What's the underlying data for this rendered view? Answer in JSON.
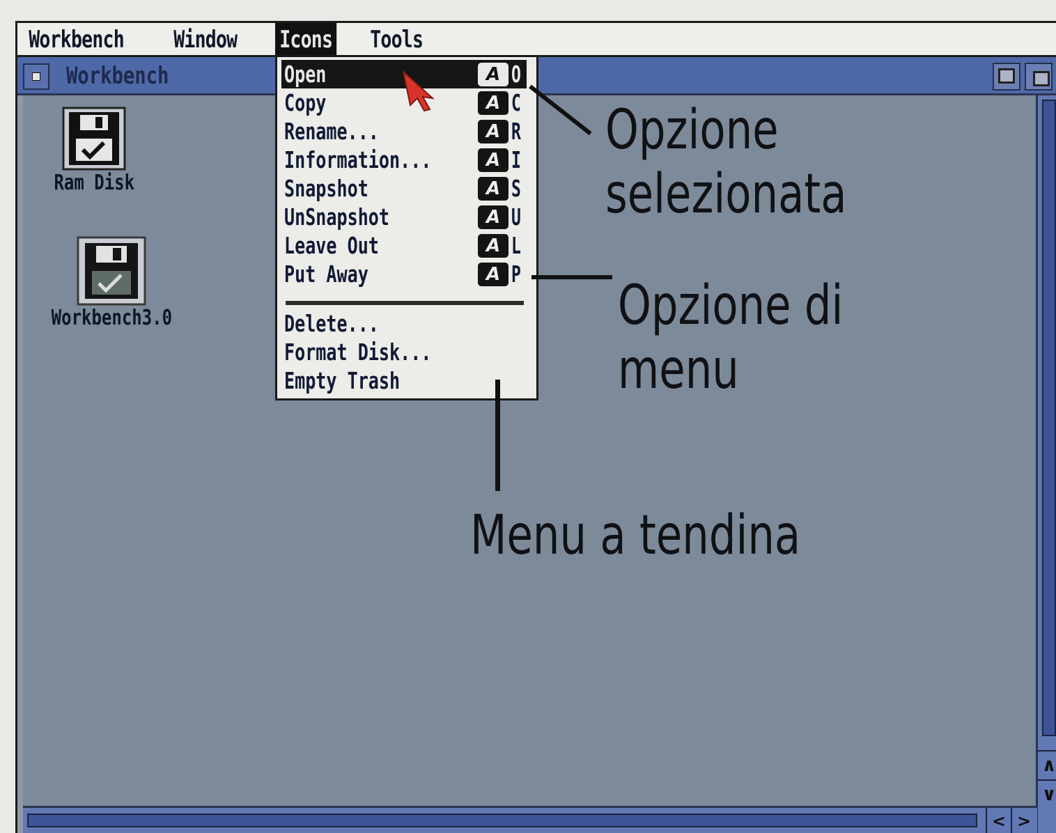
{
  "menubar": {
    "items": [
      "Workbench",
      "Window",
      "Icons",
      "Tools"
    ],
    "active": "Icons"
  },
  "window": {
    "title": "Workbench"
  },
  "desktop_icons": [
    {
      "label": "Ram Disk",
      "icon": "ram-disk-icon"
    },
    {
      "label": "Workbench3.0",
      "icon": "floppy-disk-icon"
    }
  ],
  "dropdown": {
    "shortcut_key_glyph": "A",
    "items": [
      {
        "label": "Open",
        "key": "O",
        "selected": true
      },
      {
        "label": "Copy",
        "key": "C"
      },
      {
        "label": "Rename...",
        "key": "R"
      },
      {
        "label": "Information...",
        "key": "I"
      },
      {
        "label": "Snapshot",
        "key": "S"
      },
      {
        "label": "UnSnapshot",
        "key": "U"
      },
      {
        "label": "Leave Out",
        "key": "L"
      },
      {
        "label": "Put Away",
        "key": "P"
      }
    ],
    "items_after_separator": [
      {
        "label": "Delete..."
      },
      {
        "label": "Format Disk..."
      },
      {
        "label": "Empty Trash"
      }
    ]
  },
  "annotations": {
    "selected_option": "Opzione selezionata",
    "selected_option_line1": "Opzione",
    "selected_option_line2": "selezionata",
    "menu_option_line1": "Opzione di",
    "menu_option_line2": "menu",
    "dropdown_menu": "Menu a tendina"
  },
  "scroll_arrows": {
    "up": "∧",
    "down": "∨",
    "left": "<",
    "right": ">"
  },
  "colors": {
    "window_title_bar": "#4f68a8",
    "window_background": "#7d8a9a",
    "menu_background": "#ecece8",
    "selection": "#161616",
    "pointer": "#d8342b"
  }
}
